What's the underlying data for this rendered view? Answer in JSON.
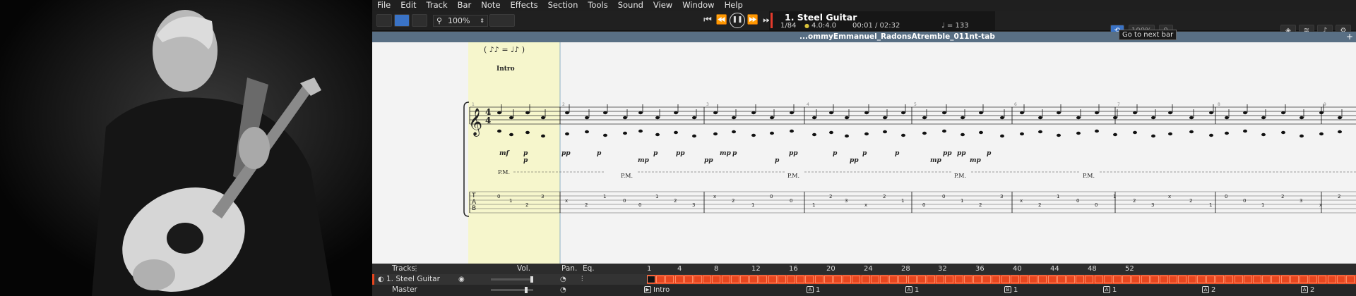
{
  "menu": [
    "File",
    "Edit",
    "Track",
    "Bar",
    "Note",
    "Effects",
    "Section",
    "Tools",
    "Sound",
    "View",
    "Window",
    "Help"
  ],
  "toolbar": {
    "zoom": "100%"
  },
  "lcd": {
    "track_title": "1. Steel Guitar",
    "bar_position": "1/84",
    "beat_position": "4.0:4.0",
    "time_position": "00:01 / 02:32",
    "tempo": "♩ = 133"
  },
  "tooltip": "Go to next bar",
  "right_tools": {
    "volume": "100%",
    "transpose": "0"
  },
  "file_tab": "...ommyEmmanuel_RadonsAtremble_011nt-tab",
  "score": {
    "tempo_note": "( ♪♪ = ♩♪ )",
    "section_intro": "Intro",
    "time_signature_top": "4",
    "time_signature_bottom": "4",
    "palm_mute": "P.M.",
    "tab_label": [
      "T",
      "A",
      "B"
    ],
    "dynamics": [
      "mf",
      "p",
      "p",
      "pp",
      "p",
      "mp",
      "p",
      "pp",
      "pp",
      "mp",
      "p",
      "p",
      "pp",
      "p",
      "pp",
      "p",
      "p",
      "mp",
      "pp",
      "pp",
      "mp",
      "p"
    ],
    "bar_numbers": [
      "1",
      "2",
      "3",
      "4",
      "5",
      "6",
      "7",
      "8",
      "9"
    ]
  },
  "tracks_panel": {
    "header": "Tracks",
    "vol_label": "Vol.",
    "pan_label": "Pan.",
    "eq_label": "Eq.",
    "track_name": "1. Steel Guitar",
    "master_name": "Master",
    "ruler": [
      "1",
      "4",
      "8",
      "12",
      "16",
      "20",
      "24",
      "28",
      "32",
      "36",
      "40",
      "44",
      "48",
      "52"
    ],
    "sections": [
      {
        "marker": "▶",
        "label": "Intro"
      },
      {
        "marker": "A",
        "label": "1"
      },
      {
        "marker": "A",
        "label": "1"
      },
      {
        "marker": "B",
        "label": "1"
      },
      {
        "marker": "A",
        "label": "1"
      },
      {
        "marker": "A",
        "label": "2"
      },
      {
        "marker": "A",
        "label": "2"
      }
    ]
  }
}
